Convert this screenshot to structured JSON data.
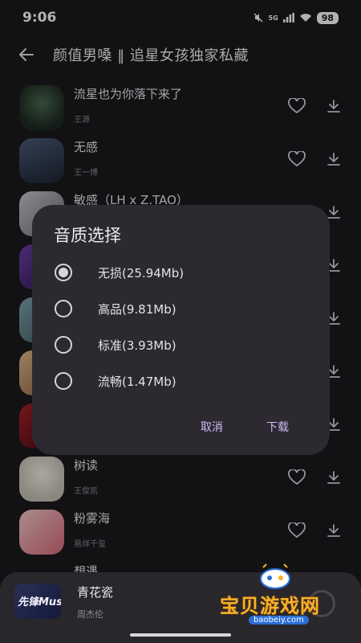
{
  "status_bar": {
    "time": "9:06",
    "network": "5G",
    "battery": "98"
  },
  "header": {
    "title": "颜值男嗓 ‖ 追星女孩独家私藏"
  },
  "songs": [
    {
      "title": "流星也为你落下来了",
      "artist": "王源"
    },
    {
      "title": "无感",
      "artist": "王一博"
    },
    {
      "title": "敏感（LH x Z.TAO）",
      "artist": ""
    },
    {
      "title": "",
      "artist": ""
    },
    {
      "title": "",
      "artist": ""
    },
    {
      "title": "",
      "artist": ""
    },
    {
      "title": "",
      "artist": ""
    },
    {
      "title": "树读",
      "artist": "王俊凯"
    },
    {
      "title": "粉雾海",
      "artist": "易烊千玺"
    },
    {
      "title": "想遇",
      "artist": ""
    }
  ],
  "dialog": {
    "title": "音质选择",
    "options": [
      {
        "label": "无损(25.94Mb)",
        "selected": true
      },
      {
        "label": "高品(9.81Mb)",
        "selected": false
      },
      {
        "label": "标准(3.93Mb)",
        "selected": false
      },
      {
        "label": "流畅(1.47Mb)",
        "selected": false
      }
    ],
    "cancel_label": "取消",
    "download_label": "下载"
  },
  "player": {
    "title": "青花瓷",
    "artist": "周杰伦",
    "cover_text": "先锋Music"
  },
  "watermark": {
    "text": "宝贝游戏网",
    "url": "baobeiy.com"
  },
  "colors": {
    "accent": "#cdbcf7",
    "background": "#1a191c",
    "dialog": "#2c2a30",
    "watermark": "#f7b22a"
  }
}
